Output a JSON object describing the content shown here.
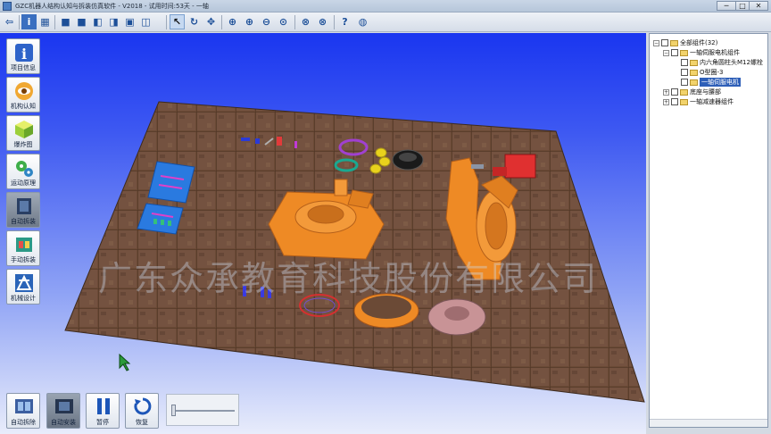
{
  "window": {
    "title": "GZC机器人结构认知与拆装仿真软件 - V2018 - 试用时间:53天 - 一轴",
    "min": "─",
    "max": "□",
    "close": "✕"
  },
  "toolbar": {
    "items": [
      {
        "name": "back-icon",
        "glyph": "⇦"
      },
      {
        "name": "info-icon",
        "glyph": "i"
      },
      {
        "name": "layout-icon",
        "glyph": "▦"
      },
      {
        "name": "view-front-icon",
        "glyph": "■"
      },
      {
        "name": "view-back-icon",
        "glyph": "■"
      },
      {
        "name": "view-left-icon",
        "glyph": "◧"
      },
      {
        "name": "view-right-icon",
        "glyph": "◨"
      },
      {
        "name": "view-top-icon",
        "glyph": "▣"
      },
      {
        "name": "view-iso-icon",
        "glyph": "◫"
      },
      {
        "name": "select-cursor-icon",
        "glyph": "↖"
      },
      {
        "name": "rotate-icon",
        "glyph": "↻"
      },
      {
        "name": "pan-icon",
        "glyph": "✥"
      },
      {
        "name": "zoom-window-icon",
        "glyph": "⊕"
      },
      {
        "name": "zoom-in-icon",
        "glyph": "⊕"
      },
      {
        "name": "zoom-out-icon",
        "glyph": "⊖"
      },
      {
        "name": "zoom-fit-icon",
        "glyph": "⊙"
      },
      {
        "name": "explode-icon",
        "glyph": "⊗"
      },
      {
        "name": "assemble-icon",
        "glyph": "⊗"
      },
      {
        "name": "help-icon",
        "glyph": "?"
      },
      {
        "name": "globe-icon",
        "glyph": "◍"
      }
    ]
  },
  "sidebar": {
    "items": [
      {
        "label": "项目信息"
      },
      {
        "label": "机构认知"
      },
      {
        "label": "爆炸图"
      },
      {
        "label": "运动原理"
      },
      {
        "label": "自动拆装"
      },
      {
        "label": "手动拆装"
      },
      {
        "label": "机械设计"
      }
    ]
  },
  "bottom": {
    "auto_disassemble": "自动拆除",
    "auto_install": "自动安装",
    "pause": "暂停",
    "restore": "恢复"
  },
  "tree": {
    "root": "全部组件(32)",
    "group1": "一轴伺服电机组件",
    "item1": "内六角圆柱头M12螺栓",
    "item2": "O型圈-3",
    "item3": "一轴伺服电机",
    "group2": "底座与腰部",
    "group3": "一轴减速器组件"
  },
  "watermark": "广东众承教育科技股份有限公司",
  "colors": {
    "floor": "#6b4a36",
    "part_orange": "#ee8a25",
    "sky_top": "#1a36f0",
    "tree_highlight": "#2e5fb8"
  }
}
